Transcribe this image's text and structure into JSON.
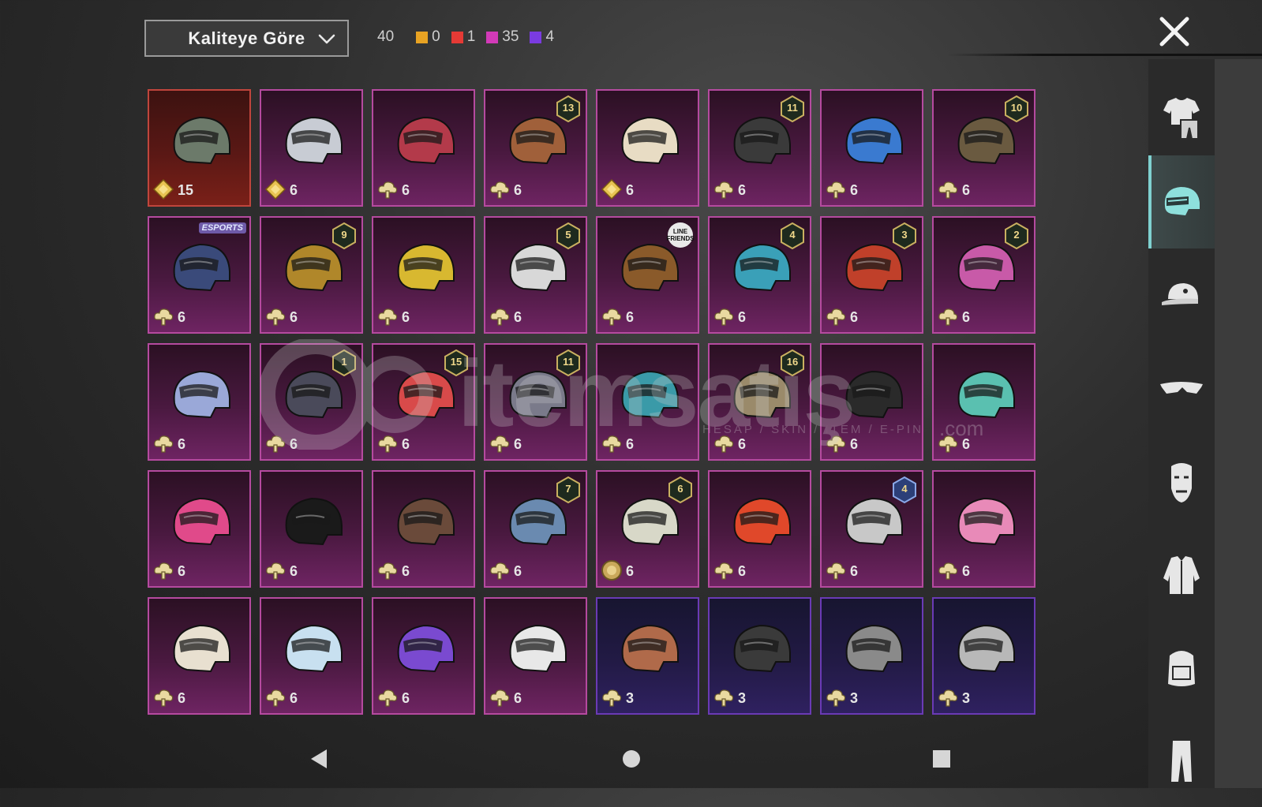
{
  "header": {
    "sort_dropdown": {
      "value": "Kaliteye Göre"
    },
    "total_count": "40",
    "quality_counts": [
      {
        "color": "#e8a323",
        "count": "0"
      },
      {
        "color": "#e53a35",
        "count": "1"
      },
      {
        "color": "#d23ab8",
        "count": "35"
      },
      {
        "color": "#7a3be0",
        "count": "4"
      }
    ],
    "close_icon": "close-icon"
  },
  "sidebar": {
    "items": [
      {
        "icon": "outfit-icon",
        "active": false
      },
      {
        "icon": "helmet-icon",
        "active": true
      },
      {
        "icon": "cap-icon",
        "active": false
      },
      {
        "icon": "glasses-icon",
        "active": false
      },
      {
        "icon": "mask-icon",
        "active": false
      },
      {
        "icon": "jacket-icon",
        "active": false
      },
      {
        "icon": "backpack-icon",
        "active": false
      },
      {
        "icon": "pants-icon",
        "active": false
      }
    ]
  },
  "items": [
    {
      "rarity": "legendary",
      "helmet_color": "#6c7a6a",
      "badge": "",
      "badge_type": "",
      "currency": "diamond-icon",
      "qty": "15"
    },
    {
      "rarity": "mythic",
      "helmet_color": "#c8ccd4",
      "badge": "",
      "badge_type": "",
      "currency": "diamond-icon",
      "qty": "6"
    },
    {
      "rarity": "mythic",
      "helmet_color": "#b33a4a",
      "badge": "",
      "badge_type": "",
      "currency": "cloud-icon",
      "qty": "6"
    },
    {
      "rarity": "mythic",
      "helmet_color": "#a0603a",
      "badge": "13",
      "badge_type": "level",
      "currency": "cloud-icon",
      "qty": "6"
    },
    {
      "rarity": "mythic",
      "helmet_color": "#e8dcc4",
      "badge": "",
      "badge_type": "",
      "currency": "diamond-icon",
      "qty": "6"
    },
    {
      "rarity": "mythic",
      "helmet_color": "#3a3a3a",
      "badge": "11",
      "badge_type": "level",
      "currency": "cloud-icon",
      "qty": "6"
    },
    {
      "rarity": "mythic",
      "helmet_color": "#3a7ad0",
      "badge": "",
      "badge_type": "",
      "currency": "cloud-icon",
      "qty": "6"
    },
    {
      "rarity": "mythic",
      "helmet_color": "#6a5a40",
      "badge": "10",
      "badge_type": "level",
      "currency": "cloud-icon",
      "qty": "6"
    },
    {
      "rarity": "mythic",
      "helmet_color": "#3a4a7a",
      "badge": "ESPORTS",
      "badge_type": "tag",
      "currency": "cloud-icon",
      "qty": "6"
    },
    {
      "rarity": "mythic",
      "helmet_color": "#b0872a",
      "badge": "9",
      "badge_type": "level",
      "currency": "cloud-icon",
      "qty": "6"
    },
    {
      "rarity": "mythic",
      "helmet_color": "#d8b830",
      "badge": "",
      "badge_type": "",
      "currency": "cloud-icon",
      "qty": "6"
    },
    {
      "rarity": "mythic",
      "helmet_color": "#d8d8d8",
      "badge": "5",
      "badge_type": "level",
      "currency": "cloud-icon",
      "qty": "6"
    },
    {
      "rarity": "mythic",
      "helmet_color": "#8a5a2a",
      "badge": "LINE FRIENDS",
      "badge_type": "circle",
      "currency": "cloud-icon",
      "qty": "6"
    },
    {
      "rarity": "mythic",
      "helmet_color": "#3aa0b8",
      "badge": "4",
      "badge_type": "level",
      "currency": "cloud-icon",
      "qty": "6"
    },
    {
      "rarity": "mythic",
      "helmet_color": "#c0402a",
      "badge": "3",
      "badge_type": "level",
      "currency": "cloud-icon",
      "qty": "6"
    },
    {
      "rarity": "mythic",
      "helmet_color": "#c85aa8",
      "badge": "2",
      "badge_type": "level",
      "currency": "cloud-icon",
      "qty": "6"
    },
    {
      "rarity": "mythic",
      "helmet_color": "#9aa8d8",
      "badge": "",
      "badge_type": "",
      "currency": "cloud-icon",
      "qty": "6"
    },
    {
      "rarity": "mythic",
      "helmet_color": "#4a4a5a",
      "badge": "1",
      "badge_type": "level",
      "currency": "cloud-icon",
      "qty": "6"
    },
    {
      "rarity": "mythic",
      "helmet_color": "#d84a4a",
      "badge": "15",
      "badge_type": "level",
      "currency": "cloud-icon",
      "qty": "6"
    },
    {
      "rarity": "mythic",
      "helmet_color": "#7a7a8a",
      "badge": "11",
      "badge_type": "level",
      "currency": "cloud-icon",
      "qty": "6"
    },
    {
      "rarity": "mythic",
      "helmet_color": "#3a9aa8",
      "badge": "",
      "badge_type": "",
      "currency": "cloud-icon",
      "qty": "6"
    },
    {
      "rarity": "mythic",
      "helmet_color": "#9a8a6a",
      "badge": "16",
      "badge_type": "level",
      "currency": "cloud-icon",
      "qty": "6"
    },
    {
      "rarity": "mythic",
      "helmet_color": "#2a2a2a",
      "badge": "",
      "badge_type": "",
      "currency": "cloud-icon",
      "qty": "6"
    },
    {
      "rarity": "mythic",
      "helmet_color": "#5ac0b0",
      "badge": "",
      "badge_type": "",
      "currency": "cloud-icon",
      "qty": "6"
    },
    {
      "rarity": "mythic",
      "helmet_color": "#e04a8a",
      "badge": "",
      "badge_type": "",
      "currency": "cloud-icon",
      "qty": "6"
    },
    {
      "rarity": "mythic",
      "helmet_color": "#1a1a1a",
      "badge": "",
      "badge_type": "",
      "currency": "cloud-icon",
      "qty": "6"
    },
    {
      "rarity": "mythic",
      "helmet_color": "#6a4a3a",
      "badge": "",
      "badge_type": "",
      "currency": "cloud-icon",
      "qty": "6"
    },
    {
      "rarity": "mythic",
      "helmet_color": "#6a8ab0",
      "badge": "7",
      "badge_type": "level",
      "currency": "cloud-icon",
      "qty": "6"
    },
    {
      "rarity": "mythic",
      "helmet_color": "#d8d8c8",
      "badge": "6",
      "badge_type": "level",
      "currency": "coin-icon",
      "qty": "6"
    },
    {
      "rarity": "mythic",
      "helmet_color": "#e0482a",
      "badge": "",
      "badge_type": "",
      "currency": "cloud-icon",
      "qty": "6"
    },
    {
      "rarity": "mythic",
      "helmet_color": "#c8c8c8",
      "badge": "4",
      "badge_type": "level-blue",
      "currency": "cloud-icon",
      "qty": "6"
    },
    {
      "rarity": "mythic",
      "helmet_color": "#e88ab8",
      "badge": "",
      "badge_type": "",
      "currency": "cloud-icon",
      "qty": "6"
    },
    {
      "rarity": "mythic",
      "helmet_color": "#e8e0d0",
      "badge": "",
      "badge_type": "",
      "currency": "cloud-icon",
      "qty": "6"
    },
    {
      "rarity": "mythic",
      "helmet_color": "#c8e0f0",
      "badge": "",
      "badge_type": "",
      "currency": "cloud-icon",
      "qty": "6"
    },
    {
      "rarity": "mythic",
      "helmet_color": "#7a4ad0",
      "badge": "",
      "badge_type": "",
      "currency": "cloud-icon",
      "qty": "6"
    },
    {
      "rarity": "mythic",
      "helmet_color": "#e8e8e8",
      "badge": "",
      "badge_type": "",
      "currency": "cloud-icon",
      "qty": "6"
    },
    {
      "rarity": "epic",
      "helmet_color": "#b06a4a",
      "badge": "",
      "badge_type": "",
      "currency": "cloud-icon",
      "qty": "3"
    },
    {
      "rarity": "epic",
      "helmet_color": "#3a3a3a",
      "badge": "",
      "badge_type": "",
      "currency": "cloud-icon",
      "qty": "3"
    },
    {
      "rarity": "epic",
      "helmet_color": "#8a8a8a",
      "badge": "",
      "badge_type": "",
      "currency": "cloud-icon",
      "qty": "3"
    },
    {
      "rarity": "epic",
      "helmet_color": "#b8b8b8",
      "badge": "",
      "badge_type": "",
      "currency": "cloud-icon",
      "qty": "3"
    }
  ],
  "watermark": {
    "text": "itemsatış",
    "sub": "HESAP / SKIN / ITEM / E-PIN",
    "domain": ".com"
  },
  "navbar": {
    "buttons": [
      "back-icon",
      "home-icon",
      "recents-icon"
    ]
  }
}
